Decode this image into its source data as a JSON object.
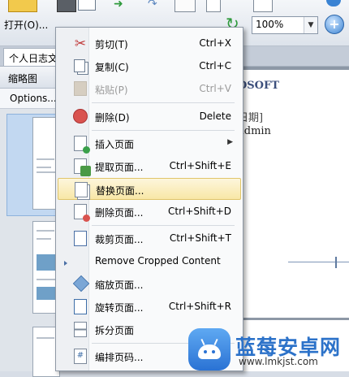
{
  "toolbar": {
    "open_label": "打开(O)...",
    "zoom_value": "100%",
    "icons": [
      "open-folder-icon",
      "print-icon",
      "mail-icon",
      "forward-icon",
      "redo-icon",
      "hand-tool-icon",
      "select-tool-icon",
      "rotate-icon",
      "fit-page-icon",
      "zoom-in-icon"
    ]
  },
  "tabs": {
    "document_tab": "个人日志文"
  },
  "thumbnail_panel": {
    "title": "缩略图",
    "options_label": "Options..."
  },
  "document": {
    "company": "DSOFT",
    "date_line": "日期]",
    "author_line": "admin"
  },
  "context_menu": {
    "items": [
      {
        "label": "剪切(T)",
        "shortcut": "Ctrl+X",
        "icon": "scissors-icon",
        "enabled": true
      },
      {
        "label": "复制(C)",
        "shortcut": "Ctrl+C",
        "icon": "copy-icon",
        "enabled": true
      },
      {
        "label": "粘贴(P)",
        "shortcut": "Ctrl+V",
        "icon": "paste-icon",
        "enabled": false
      },
      {
        "label": "删除(D)",
        "shortcut": "Delete",
        "icon": "delete-icon",
        "enabled": true
      },
      {
        "label": "插入页面",
        "shortcut": "",
        "icon": "insert-page-icon",
        "enabled": true,
        "submenu": true
      },
      {
        "label": "提取页面...",
        "shortcut": "Ctrl+Shift+E",
        "icon": "extract-page-icon",
        "enabled": true
      },
      {
        "label": "替换页面...",
        "shortcut": "",
        "icon": "replace-page-icon",
        "enabled": true,
        "highlighted": true
      },
      {
        "label": "删除页面...",
        "shortcut": "Ctrl+Shift+D",
        "icon": "delete-page-icon",
        "enabled": true
      },
      {
        "label": "裁剪页面...",
        "shortcut": "Ctrl+Shift+T",
        "icon": "crop-page-icon",
        "enabled": true
      },
      {
        "label": "Remove Cropped Content",
        "shortcut": "",
        "icon": "remove-cropped-icon",
        "enabled": true
      },
      {
        "label": "缩放页面...",
        "shortcut": "",
        "icon": "resize-page-icon",
        "enabled": true
      },
      {
        "label": "旋转页面...",
        "shortcut": "Ctrl+Shift+R",
        "icon": "rotate-page-icon",
        "enabled": true
      },
      {
        "label": "拆分页面",
        "shortcut": "",
        "icon": "split-page-icon",
        "enabled": true
      },
      {
        "label": "编排页码...",
        "shortcut": "",
        "icon": "page-number-icon",
        "enabled": true
      }
    ]
  },
  "watermark": {
    "title": "蓝莓安卓网",
    "url": "www.lmkjst.com"
  },
  "colors": {
    "menu_highlight": "#f8e7a6",
    "accent_blue": "#2c72c9",
    "delete_red": "#d9534f",
    "insert_green": "#3aa04a"
  }
}
